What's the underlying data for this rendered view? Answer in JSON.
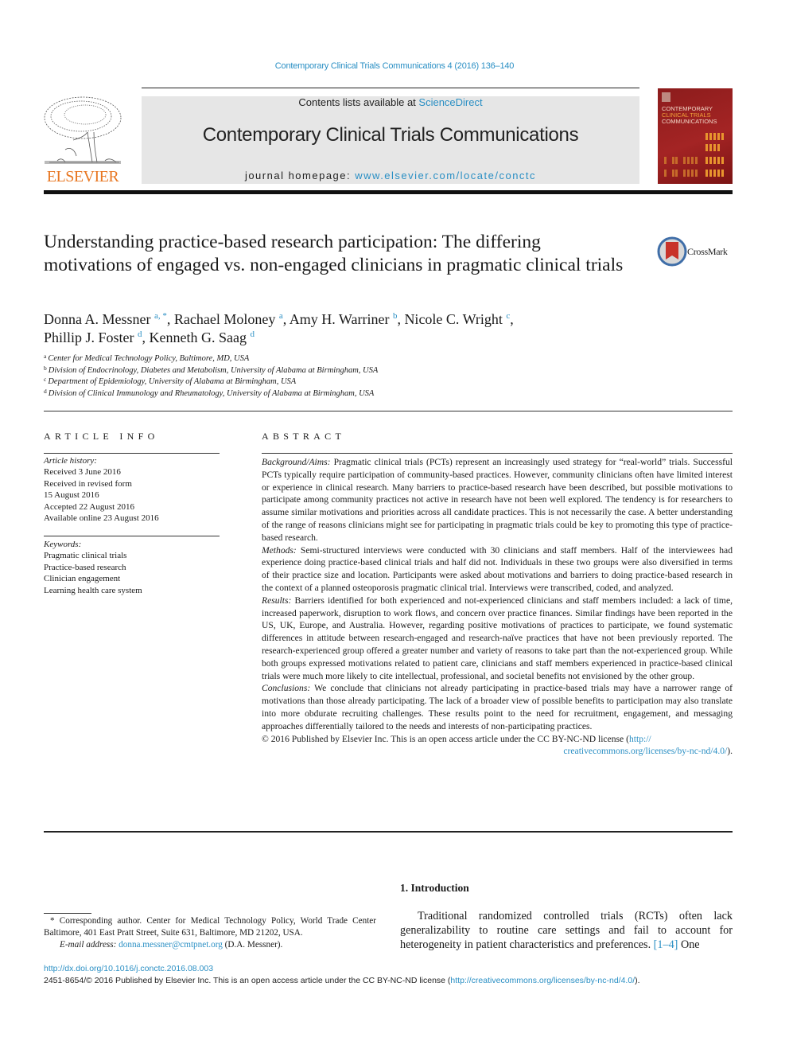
{
  "running_head": "Contemporary Clinical Trials Communications 4 (2016) 136–140",
  "masthead": {
    "contents_prefix": "Contents lists available at ",
    "contents_link": "ScienceDirect",
    "journal_title": "Contemporary Clinical Trials Communications",
    "homepage_prefix": "journal homepage: ",
    "homepage_link": "www.elsevier.com/locate/conctc",
    "publisher_logo_text": "ELSEVIER",
    "cover": {
      "line1": "CONTEMPORARY",
      "line2": "CLINICAL TRIALS",
      "line3": "COMMUNICATIONS"
    }
  },
  "article": {
    "title": "Understanding practice-based research participation: The differing motivations of engaged vs. non-engaged clinicians in pragmatic clinical trials",
    "crossmark_label": "CrossMark",
    "authors": [
      {
        "name": "Donna A. Messner",
        "sup": "a, *",
        "sep": ", "
      },
      {
        "name": "Rachael Moloney",
        "sup": "a",
        "sep": ", "
      },
      {
        "name": "Amy H. Warriner",
        "sup": "b",
        "sep": ", "
      },
      {
        "name": "Nicole C. Wright",
        "sup": "c",
        "sep": ","
      },
      {
        "name": "Phillip J. Foster",
        "sup": "d",
        "sep": ", "
      },
      {
        "name": "Kenneth G. Saag",
        "sup": "d",
        "sep": ""
      }
    ],
    "affiliations": [
      {
        "key": "a",
        "text": "Center for Medical Technology Policy, Baltimore, MD, USA"
      },
      {
        "key": "b",
        "text": "Division of Endocrinology, Diabetes and Metabolism, University of Alabama at Birmingham, USA"
      },
      {
        "key": "c",
        "text": "Department of Epidemiology, University of Alabama at Birmingham, USA"
      },
      {
        "key": "d",
        "text": "Division of Clinical Immunology and Rheumatology, University of Alabama at Birmingham, USA"
      }
    ]
  },
  "article_info": {
    "heading": "ARTICLE INFO",
    "history_label": "Article history:",
    "history": [
      "Received 3 June 2016",
      "Received in revised form",
      "15 August 2016",
      "Accepted 22 August 2016",
      "Available online 23 August 2016"
    ],
    "keywords_label": "Keywords:",
    "keywords": [
      "Pragmatic clinical trials",
      "Practice-based research",
      "Clinician engagement",
      "Learning health care system"
    ]
  },
  "abstract": {
    "heading": "ABSTRACT",
    "sections": [
      {
        "label": "Background/Aims:",
        "text": " Pragmatic clinical trials (PCTs) represent an increasingly used strategy for “real-world” trials. Successful PCTs typically require participation of community-based practices. However, community clinicians often have limited interest or experience in clinical research. Many barriers to practice-based research have been described, but possible motivations to participate among community practices not active in research have not been well explored. The tendency is for researchers to assume similar motivations and priorities across all candidate practices. This is not necessarily the case. A better understanding of the range of reasons clinicians might see for participating in pragmatic trials could be key to promoting this type of practice-based research."
      },
      {
        "label": "Methods:",
        "text": " Semi-structured interviews were conducted with 30 clinicians and staff members. Half of the interviewees had experience doing practice-based clinical trials and half did not. Individuals in these two groups were also diversified in terms of their practice size and location. Participants were asked about motivations and barriers to doing practice-based research in the context of a planned osteoporosis pragmatic clinical trial. Interviews were transcribed, coded, and analyzed."
      },
      {
        "label": "Results:",
        "text": " Barriers identified for both experienced and not-experienced clinicians and staff members included: a lack of time, increased paperwork, disruption to work flows, and concern over practice finances. Similar findings have been reported in the US, UK, Europe, and Australia. However, regarding positive motivations of practices to participate, we found systematic differences in attitude between research-engaged and research-naïve practices that have not been previously reported. The research-experienced group offered a greater number and variety of reasons to take part than the not-experienced group. While both groups expressed motivations related to patient care, clinicians and staff members experienced in practice-based clinical trials were much more likely to cite intellectual, professional, and societal benefits not envisioned by the other group."
      },
      {
        "label": "Conclusions:",
        "text": " We conclude that clinicians not already participating in practice-based trials may have a narrower range of motivations than those already participating. The lack of a broader view of possible benefits to participation may also translate into more obdurate recruiting challenges. These results point to the need for recruitment, engagement, and messaging approaches differentially tailored to the needs and interests of non-participating practices."
      }
    ],
    "copyright_text": "© 2016 Published by Elsevier Inc. This is an open access article under the CC BY-NC-ND license (",
    "license_link_part1": "http://",
    "license_link_part2": "creativecommons.org/licenses/by-nc-nd/4.0/",
    "copyright_close": ")."
  },
  "footnote": {
    "corresponding": "* Corresponding author. Center for Medical Technology Policy, World Trade Center Baltimore, 401 East Pratt Street, Suite 631, Baltimore, MD 21202, USA.",
    "email_label": "E-mail address:",
    "email": "donna.messner@cmtpnet.org",
    "email_suffix": " (D.A. Messner)."
  },
  "introduction": {
    "heading": "1.  Introduction",
    "text": "Traditional randomized controlled trials (RCTs) often lack generalizability to routine care settings and fail to account for heterogeneity in patient characteristics and preferences. ",
    "citation": "[1–4]",
    "tail": " One"
  },
  "footer": {
    "doi": "http://dx.doi.org/10.1016/j.conctc.2016.08.003",
    "issn_text": "2451-8654/© 2016 Published by Elsevier Inc. This is an open access article under the CC BY-NC-ND license (",
    "license_link": "http://creativecommons.org/licenses/by-nc-nd/4.0/",
    "issn_close": ")."
  },
  "colors": {
    "link": "#2a8fc4",
    "elsevier_orange": "#e87722",
    "cover_red": "#a42424",
    "masthead_gray": "#e6e6e6"
  }
}
